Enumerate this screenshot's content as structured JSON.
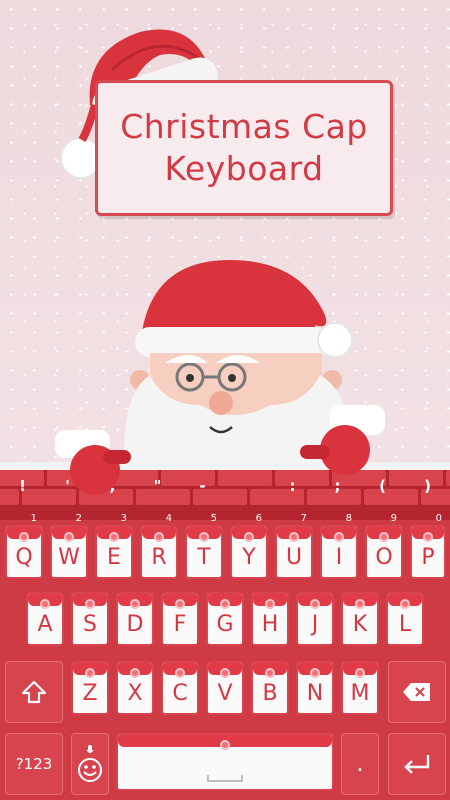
{
  "banner": {
    "title_line1": "Christmas Cap",
    "title_line2": "Keyboard"
  },
  "symbols_row": [
    "!",
    "'",
    ",",
    "\"",
    "-",
    "",
    ":",
    ";",
    "(",
    ")"
  ],
  "number_hints": [
    "1",
    "2",
    "3",
    "4",
    "5",
    "6",
    "7",
    "8",
    "9",
    "0"
  ],
  "keyboard": {
    "row1": [
      "Q",
      "W",
      "E",
      "R",
      "T",
      "Y",
      "U",
      "I",
      "O",
      "P"
    ],
    "row2": [
      "A",
      "S",
      "D",
      "F",
      "G",
      "H",
      "J",
      "K",
      "L"
    ],
    "row3": [
      "Z",
      "X",
      "C",
      "V",
      "B",
      "N",
      "M"
    ],
    "numbers_label": "?123",
    "period_label": ".",
    "icons": {
      "shift": "shift-arrow-icon",
      "backspace": "backspace-icon",
      "emoji": "smiley-icon",
      "mic": "microphone-icon",
      "space": "space-bar-icon",
      "enter": "enter-arrow-icon"
    }
  },
  "colors": {
    "primary_red": "#d7444d",
    "background_pink": "#efdcdf",
    "key_white": "#fafafa"
  }
}
